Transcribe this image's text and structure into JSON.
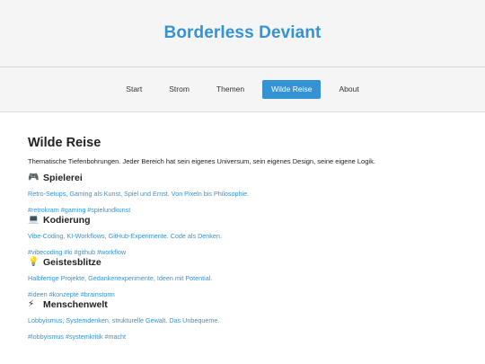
{
  "site": {
    "title": "Borderless Deviant"
  },
  "nav": {
    "items": [
      {
        "label": "Start",
        "active": false
      },
      {
        "label": "Strom",
        "active": false
      },
      {
        "label": "Themen",
        "active": false
      },
      {
        "label": "Wilde Reise",
        "active": true
      },
      {
        "label": "About",
        "active": false
      }
    ]
  },
  "page": {
    "title": "Wilde Reise",
    "intro": "Thematische Tiefenbohrungen. Jeder Bereich hat sein eigenes Universum, sein eigenes Design, seine eigene Logik."
  },
  "sections": [
    {
      "icon": "🎮",
      "icon_name": "gamepad-icon",
      "title": "Spielerei",
      "description": "Retro-Setups, Gaming als Kunst, Spiel und Ernst. Von Pixeln bis Philosophie.",
      "tags": "#retrokram #gaming #spielundkunst"
    },
    {
      "icon": "💻",
      "icon_name": "laptop-icon",
      "title": "Kodierung",
      "description": "Vibe-Coding, KI-Workflows, GitHub-Experimente. Code als Denken.",
      "tags": "#vibecoding #ki #github #workflow"
    },
    {
      "icon": "💡",
      "icon_name": "lightbulb-icon",
      "title": "Geistesblitze",
      "description": "Halbfertige Projekte, Gedankenexperimente, Ideen mit Potential.",
      "tags": "#ideen #konzepte #brainstorm"
    },
    {
      "icon": "⚡",
      "icon_name": "lightning-icon",
      "title": "Menschenwelt",
      "description": "Lobbyismus, Systemdenken, strukturelle Gewalt. Das Unbequeme.",
      "tags": "#lobbyismus #systemkritik #macht"
    }
  ],
  "colors": {
    "accent": "#3593d3",
    "header_bg": "#f5f5f5",
    "text": "#222222"
  }
}
